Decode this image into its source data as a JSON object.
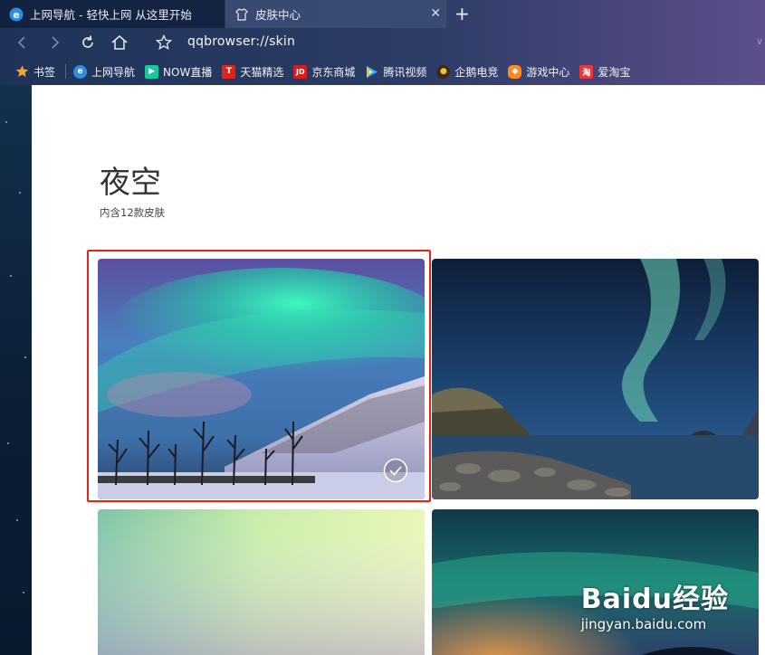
{
  "tabs": [
    {
      "title": "上网导航 - 轻快上网 从这里开始",
      "icon": "ie-e-icon"
    },
    {
      "title": "皮肤中心",
      "icon": "tshirt-icon"
    }
  ],
  "address": {
    "url": "qqbrowser://skin"
  },
  "bookmarks": [
    {
      "label": "书签",
      "icon": "star-icon"
    },
    {
      "label": "上网导航",
      "icon": "ie-e-icon"
    },
    {
      "label": "NOW直播",
      "icon": "now-icon"
    },
    {
      "label": "天猫精选",
      "icon": "tmall-icon"
    },
    {
      "label": "京东商城",
      "icon": "jd-icon"
    },
    {
      "label": "腾讯视频",
      "icon": "tencent-video-icon"
    },
    {
      "label": "企鹅电竞",
      "icon": "penguin-icon"
    },
    {
      "label": "游戏中心",
      "icon": "gamepad-icon"
    },
    {
      "label": "爱淘宝",
      "icon": "taobao-icon"
    }
  ],
  "page": {
    "title": "夜空",
    "subtitle": "内含12款皮肤"
  },
  "skins": [
    {
      "name": "aurora-mountain",
      "selected": true
    },
    {
      "name": "aurora-coast",
      "selected": false
    },
    {
      "name": "aurora-green",
      "selected": false
    },
    {
      "name": "aurora-night",
      "selected": false
    }
  ],
  "watermark": {
    "brand": "Baidu经验",
    "site": "jingyan.baidu.com"
  },
  "colors": {
    "selection": "#e2231a",
    "chrome_start": "#1f3358",
    "chrome_end": "#5d4f8a"
  }
}
